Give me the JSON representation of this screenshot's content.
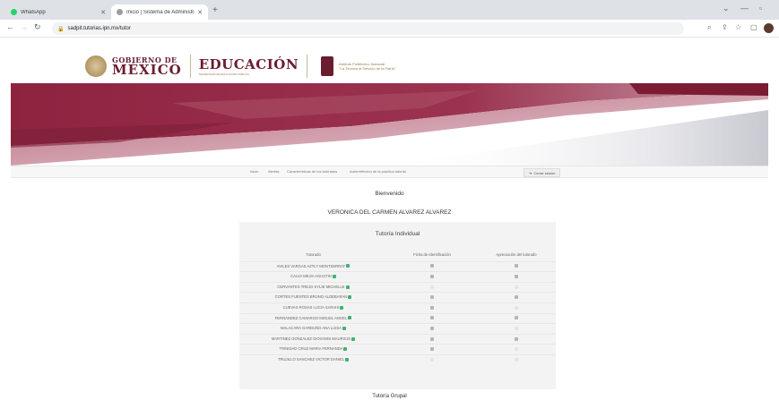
{
  "browser": {
    "tabs": [
      {
        "title": "WhatsApp",
        "favicon_color": "#25d366"
      },
      {
        "title": "Inicio | Sistema de Administraci",
        "favicon_color": "#9e9e9e"
      }
    ],
    "url": "sadpit.tutorias.ipn.mx/tutor"
  },
  "header": {
    "gobierno_line1": "GOBIERNO DE",
    "gobierno_line2": "MÉXICO",
    "educacion": "EDUCACIÓN",
    "educacion_sub": "SECRETARÍA DE EDUCACIÓN PÚBLICA",
    "ipn_line1": "Instituto Politécnico Nacional",
    "ipn_line2": "\"La Técnica al Servicio de la Patria\""
  },
  "menu": {
    "items": [
      "Inicio",
      "Alertas",
      "Características de los tutorados",
      "Autorreflexión de la práctica tutorial"
    ],
    "logout": "Cerrar sesión"
  },
  "welcome": "Bienvenido",
  "user_name": "VERONICA DEL CARMEN ALVAREZ ALVAREZ",
  "individual": {
    "title": "Tutoría Individual",
    "columns": [
      "Tutorado",
      "Ficha de Identificación",
      "Apreciación del tutorado"
    ],
    "rows": [
      {
        "name": "AVILES VARGAS AZTLY MONTSERRAT",
        "ficha": true,
        "apreciacion": true
      },
      {
        "name": "CALVA MEJIA AGUSTIN",
        "ficha": true,
        "apreciacion": true
      },
      {
        "name": "CERVANTES TREJO KYLIE MICHELLE",
        "ficha": false,
        "apreciacion": false
      },
      {
        "name": "CORTES FUENTES BRUNO ALDEBARAN",
        "ficha": true,
        "apreciacion": true
      },
      {
        "name": "CUEVAS ROSAS LUCIA SARAHI",
        "ficha": true,
        "apreciacion": false
      },
      {
        "name": "FERNANDEZ CAMARGO MIGUEL ANGEL",
        "ficha": true,
        "apreciacion": true
      },
      {
        "name": "MALACARA GARDUÑO ANA LUISA",
        "ficha": true,
        "apreciacion": false
      },
      {
        "name": "MARTINEZ GONZALEZ GIOVANNI MAURICIO",
        "ficha": true,
        "apreciacion": true
      },
      {
        "name": "TRINIDAD CRUZ MARIA FERNANDA",
        "ficha": true,
        "apreciacion": false
      },
      {
        "name": "TRUJILLO SANCHEZ VICTOR DANIEL",
        "ficha": false,
        "apreciacion": false
      }
    ]
  },
  "grupal_title": "Tutoría Grupal",
  "colors": {
    "brand_guinda": "#6a1d2f",
    "banner_red": "#8e2340",
    "status_green": "#3cb371"
  }
}
